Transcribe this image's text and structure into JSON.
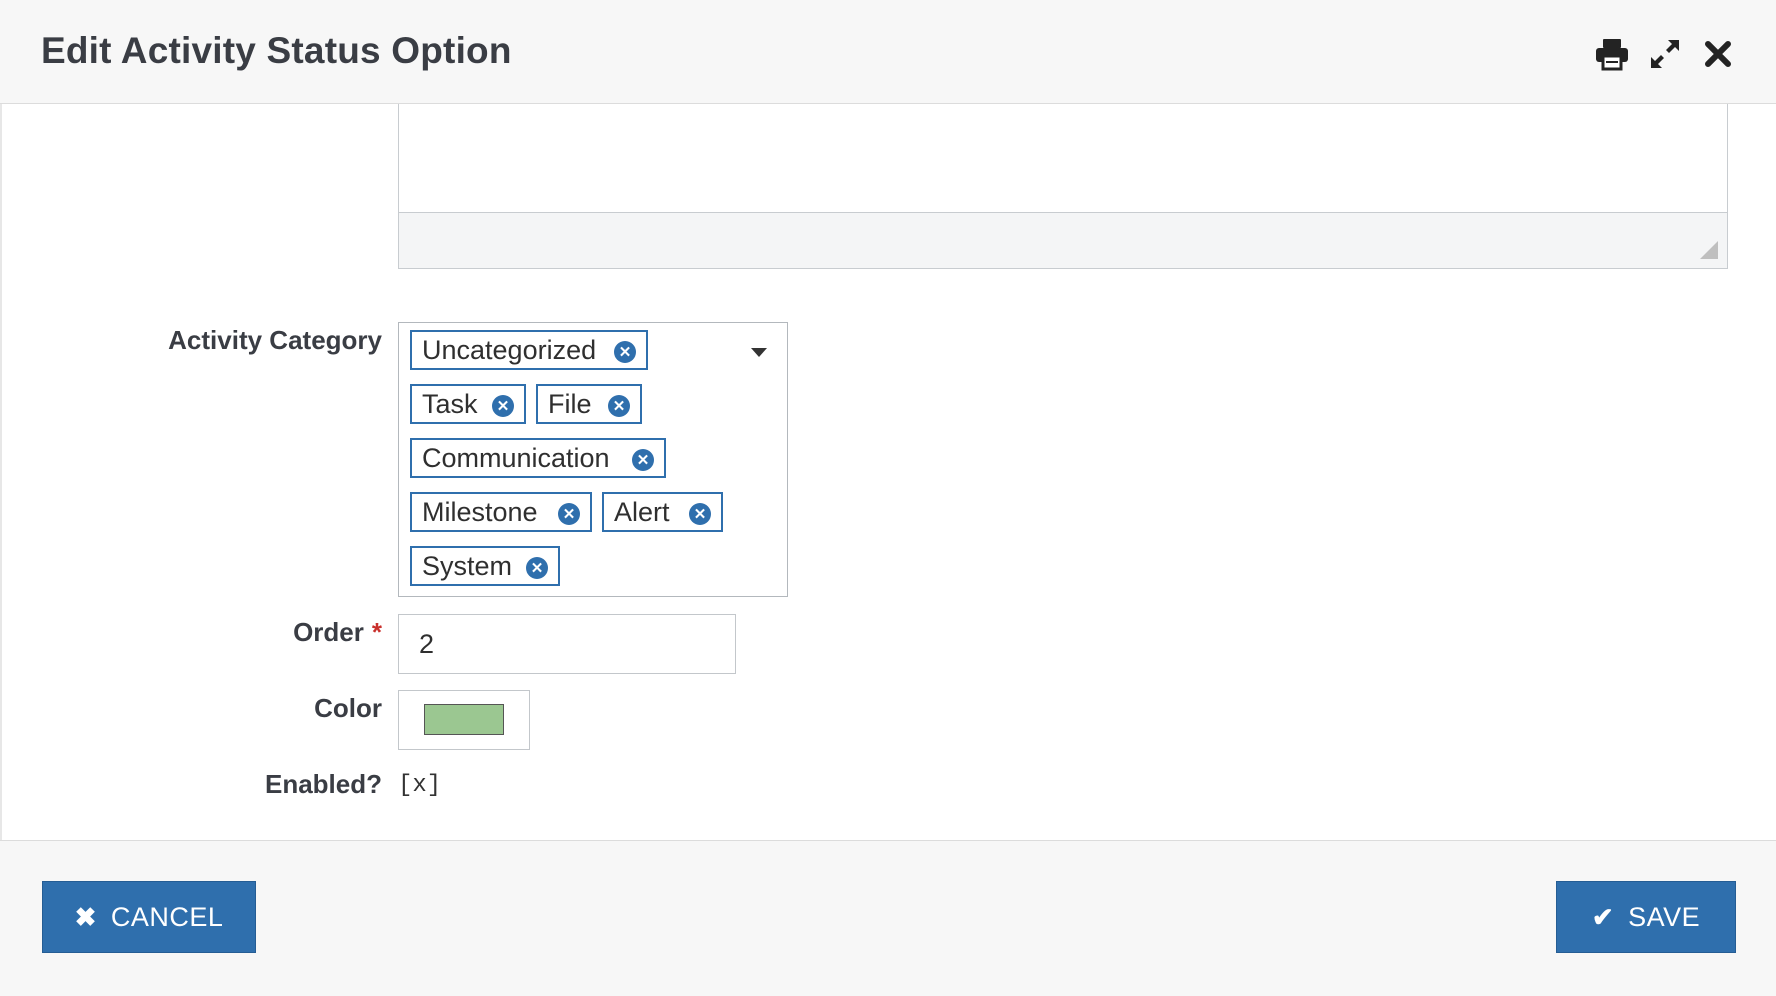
{
  "dialog": {
    "title": "Edit Activity Status Option",
    "header_icons": [
      "print-icon",
      "expand-icon",
      "close-icon"
    ]
  },
  "form": {
    "activity_category": {
      "label": "Activity Category",
      "tags": [
        "Uncategorized",
        "Task",
        "File",
        "Communication",
        "Milestone",
        "Alert",
        "System"
      ]
    },
    "order": {
      "label": "Order",
      "required_mark": "*",
      "value": "2"
    },
    "color": {
      "label": "Color",
      "value": "#9bc791"
    },
    "enabled": {
      "label": "Enabled?",
      "value": "[x]"
    }
  },
  "footer": {
    "cancel_label": "CANCEL",
    "cancel_icon": "times-icon",
    "save_label": "SAVE",
    "save_icon": "check-icon"
  },
  "colors": {
    "primary": "#2f6fad",
    "required": "#c9302c"
  }
}
